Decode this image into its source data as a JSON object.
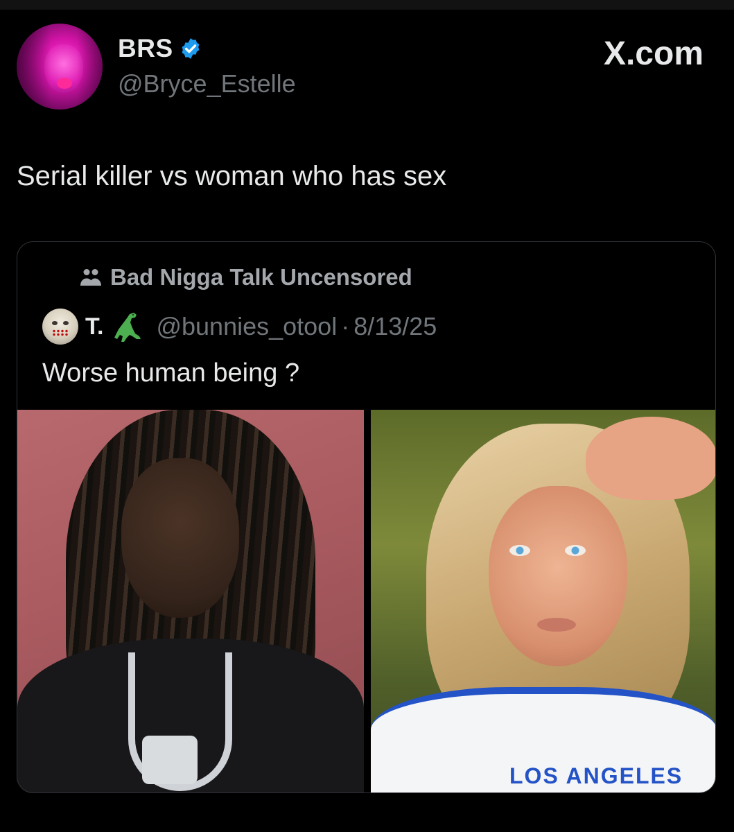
{
  "tweet": {
    "author": {
      "display_name": "BRS",
      "handle": "@Bryce_Estelle",
      "verified": true
    },
    "brand": "X.com",
    "text": "Serial killer vs woman who has sex"
  },
  "quote": {
    "community": "Bad Nigga Talk Uncensored",
    "author": {
      "display_name": "T.",
      "emoji": "🦖",
      "handle": "@bunnies_otool",
      "separator": "·",
      "date": "8/13/25"
    },
    "text": "Worse human being ?",
    "images": [
      {
        "name": "photo-left"
      },
      {
        "name": "photo-right",
        "shirt_text": "LOS ANGELES"
      }
    ]
  },
  "colors": {
    "background": "#000000",
    "text": "#e7e9ea",
    "muted": "#71767b",
    "verified": "#1d9bf0",
    "border": "#2f3336"
  }
}
